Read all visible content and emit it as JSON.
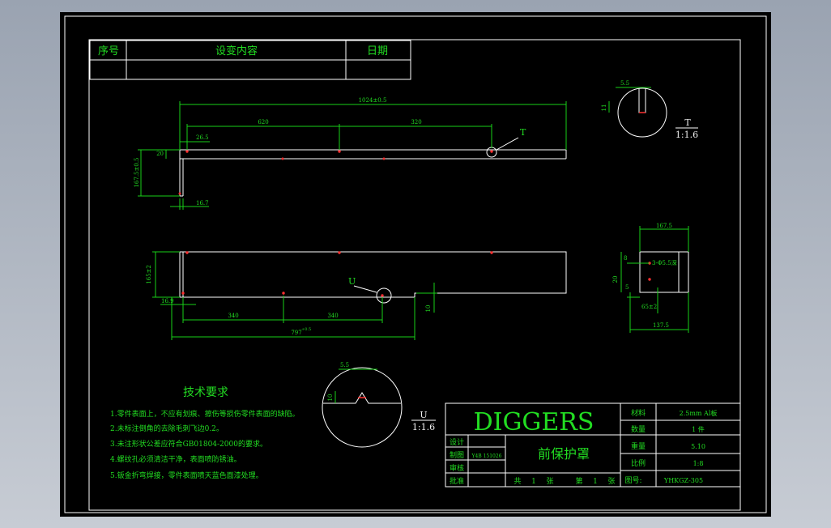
{
  "revision_table": {
    "col_no": "序号",
    "col_content": "设变内容",
    "col_date": "日期"
  },
  "views": {
    "top": {
      "dim_overall": "1024±0.5",
      "dim_620": "620",
      "dim_320": "320",
      "dim_265": "26.5",
      "dim_20": "20",
      "dim_height": "167.5±0.5",
      "dim_167": "16.7",
      "callout": "T"
    },
    "front": {
      "dim_left_height": "165±2",
      "dim_169": "16.9",
      "dim_340": "340",
      "dim_340b": "340",
      "dim_overall": "797",
      "dim_overall_tol": "+0.5",
      "dim_10": "10",
      "callout": "U"
    },
    "side": {
      "dim_top": "167.5",
      "dim_8": "8",
      "dim_phi": "3-Φ5.5深",
      "dim_20": "20",
      "dim_5": "5",
      "dim_65": "65±2",
      "dim_bottom": "137.5"
    },
    "detail_T": {
      "dim_top": "5.5",
      "dim_side": "11",
      "label": "T",
      "scale": "1:1.6"
    },
    "detail_U": {
      "dim_top": "5.5",
      "dim_side": "10",
      "label": "U",
      "scale": "1:1.6"
    }
  },
  "technical_requirements": {
    "heading": "技术要求",
    "items": [
      "1.零件表面上，不应有划痕、擦伤等损伤零件表面的缺陷。",
      "2.未标注倒角的去除毛刺飞边0.2。",
      "3.未注形状公差应符合GB01804-2000的要求。",
      "4.螺纹孔必须清洁干净，表面喷防锈油。",
      "5.钣金折弯焊接，零件表面喷天蓝色面漆处理。"
    ]
  },
  "title_block": {
    "company": "DIGGERS",
    "part_name": "前保护罩",
    "rows_left": [
      {
        "label": "设计",
        "value": ""
      },
      {
        "label": "制图",
        "value": "Y4B 151026"
      },
      {
        "label": "审核",
        "value": ""
      },
      {
        "label": "批准",
        "value": ""
      }
    ],
    "sheet_text": [
      "共",
      "1",
      "张",
      "第",
      "1",
      "张"
    ],
    "props": [
      {
        "label": "材料",
        "value": "2.5mm Al板"
      },
      {
        "label": "数量",
        "value": "1  件"
      },
      {
        "label": "重量",
        "value": "5.10"
      },
      {
        "label": "比例",
        "value": "1:8"
      }
    ],
    "drawing_no_label": "图号:",
    "drawing_no": "YHKGZ-305"
  }
}
